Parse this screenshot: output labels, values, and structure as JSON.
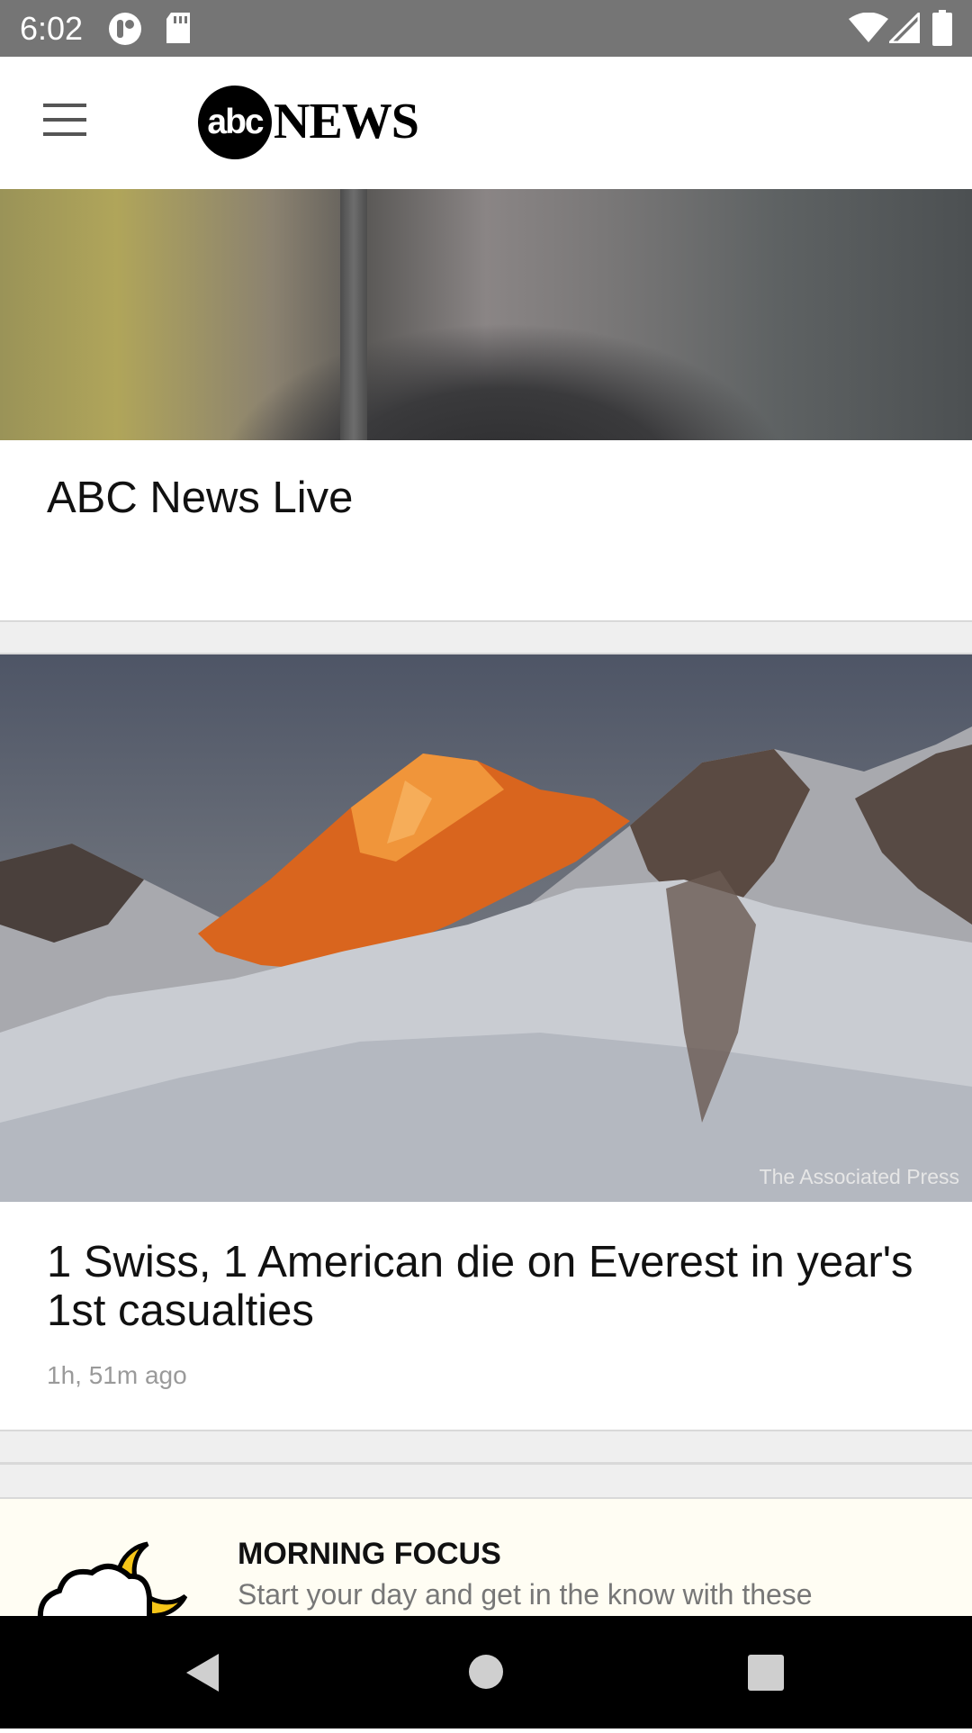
{
  "status_bar": {
    "time": "6:02",
    "icons": [
      "vpn-icon",
      "sd-card-icon",
      "wifi-icon",
      "signal-icon",
      "battery-icon"
    ]
  },
  "app_bar": {
    "menu_icon": "hamburger-menu-icon",
    "logo_abc": "abc",
    "logo_news": "NEWS"
  },
  "feed": {
    "cards": [
      {
        "title": "ABC News Live"
      },
      {
        "title": "1 Swiss, 1 American die on Everest in year's 1st casualties",
        "time": "1h, 51m ago",
        "credit": "The Associated Press"
      }
    ],
    "morning_focus": {
      "heading": "MORNING FOCUS",
      "text": "Start your day and get in the know with these"
    }
  },
  "nav_bar": {
    "buttons": [
      "back-icon",
      "home-icon",
      "recents-icon"
    ]
  },
  "colors": {
    "status_bar": "#757575",
    "focus_background": "#fffdf3",
    "moon": "#f5c518"
  }
}
